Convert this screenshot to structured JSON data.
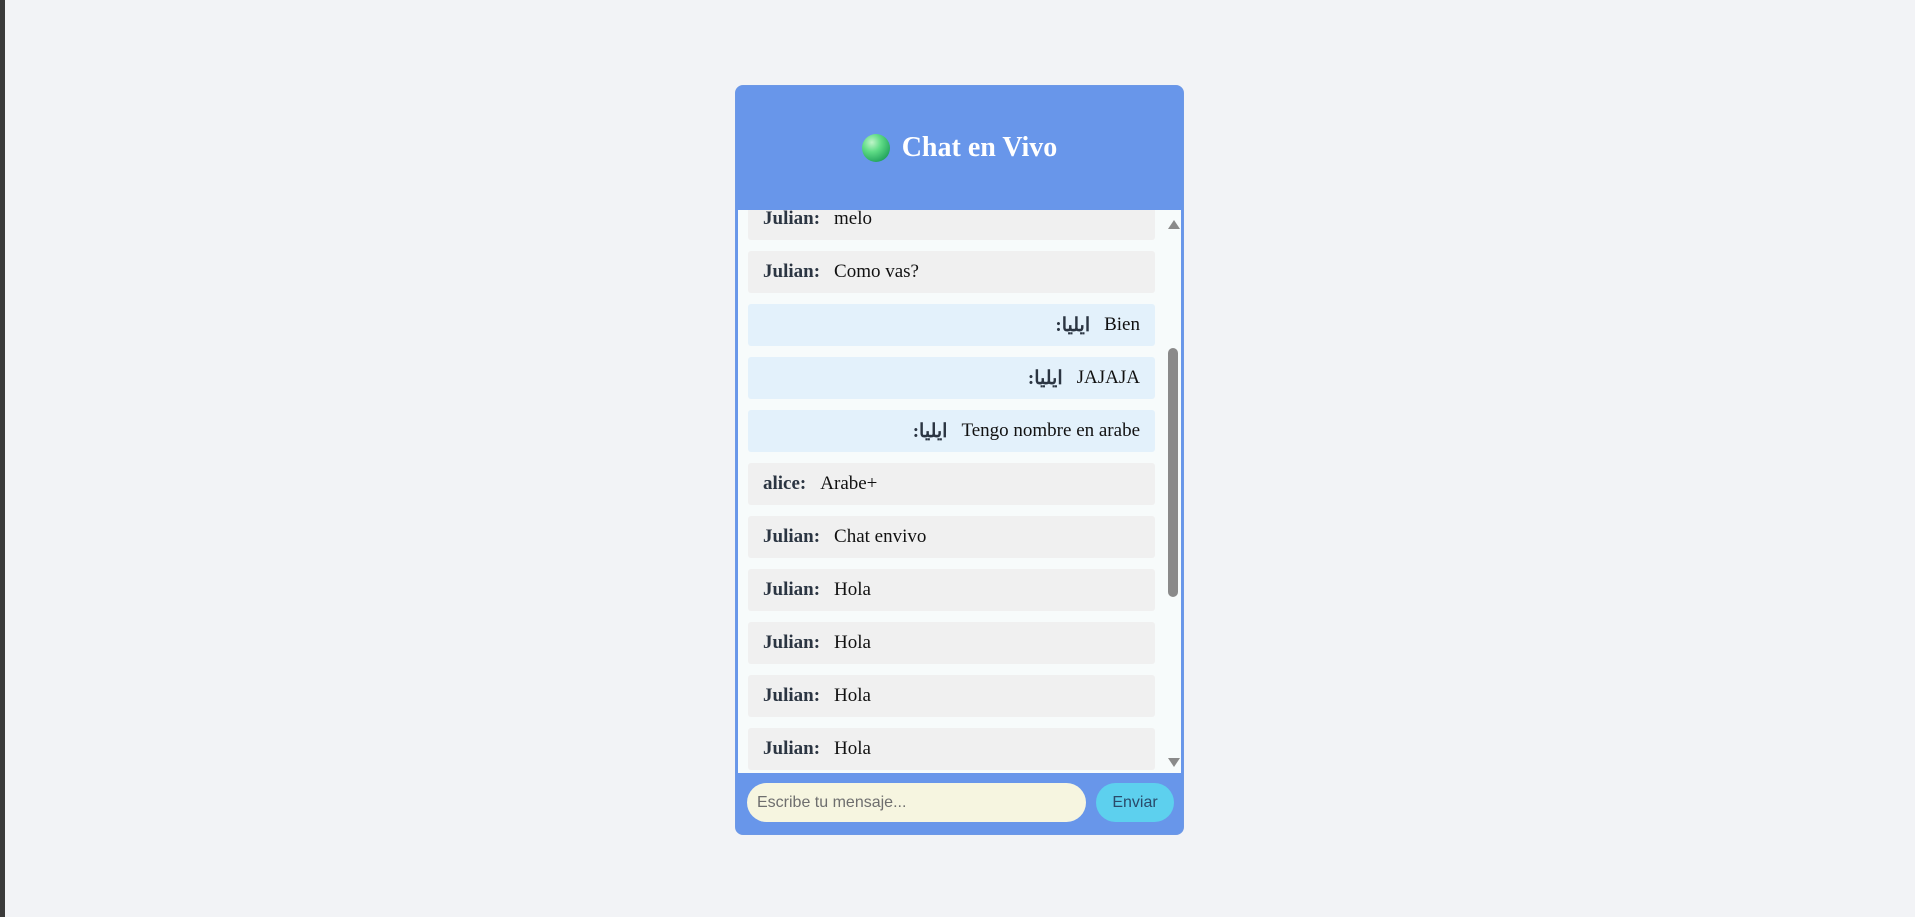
{
  "header": {
    "title": "Chat en Vivo",
    "status_icon": "online-status-icon",
    "status_color": "#2ecc71"
  },
  "messages": [
    {
      "user": "Julian:",
      "text": "melo",
      "side": "other"
    },
    {
      "user": "Julian:",
      "text": "Como vas?",
      "side": "other"
    },
    {
      "user": "ايليا:",
      "text": "Bien",
      "side": "mine"
    },
    {
      "user": "ايليا:",
      "text": "JAJAJA",
      "side": "mine"
    },
    {
      "user": "ايليا:",
      "text": "Tengo nombre en arabe",
      "side": "mine"
    },
    {
      "user": "alice:",
      "text": "Arabe+",
      "side": "other"
    },
    {
      "user": "Julian:",
      "text": "Chat envivo",
      "side": "other"
    },
    {
      "user": "Julian:",
      "text": "Hola",
      "side": "other"
    },
    {
      "user": "Julian:",
      "text": "Hola",
      "side": "other"
    },
    {
      "user": "Julian:",
      "text": "Hola",
      "side": "other"
    },
    {
      "user": "Julian:",
      "text": "Hola",
      "side": "other"
    }
  ],
  "input": {
    "placeholder": "Escribe tu mensaje...",
    "value": ""
  },
  "send_button": {
    "label": "Enviar"
  },
  "colors": {
    "accent": "#6896ea",
    "send_button": "#5dd0ee",
    "input_bg": "#f6f5e0",
    "other_bubble": "#f0f0f0",
    "mine_bubble": "#e3f1fb"
  }
}
